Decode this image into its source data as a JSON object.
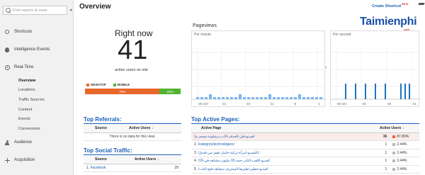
{
  "sidebar": {
    "search_placeholder": "Find reports & more",
    "collapse_glyph": "◂",
    "sections": {
      "shortcuts": "Shortcuts",
      "intelligence": "Intelligence Events",
      "realtime": "Real-Time",
      "audience": "Audience",
      "acquisition": "Acquisition"
    },
    "realtime_items": [
      "Overview",
      "Locations",
      "Traffic Sources",
      "Content",
      "Events",
      "Conversions"
    ]
  },
  "header": {
    "title": "Overview",
    "create_shortcut": "Create Shortcut",
    "beta": "BETA"
  },
  "watermark": {
    "word": "Taimienphi",
    "tld": ".vn"
  },
  "right_now": {
    "title": "Right now",
    "active_users": "41",
    "caption": "active users on site",
    "desktop_label": "DESKTOP",
    "mobile_label": "MOBILE",
    "desktop_pct": "78%",
    "mobile_pct": "22%",
    "desktop_share": 0.78,
    "desktop_color": "#e8672b",
    "mobile_color": "#50b432"
  },
  "pageviews": {
    "title": "Pageviews",
    "per_minute_label": "Per minute",
    "per_second_label": "Per second",
    "minute_ticks": [
      "-26 min",
      "-21",
      "-16",
      "-11",
      "-6",
      "-1"
    ],
    "second_ticks": [
      "-60 sec",
      "-45",
      "-30",
      "-15"
    ],
    "arrow_glyph": "›",
    "bar_color": "#7cb5ec",
    "sec_bar_color": "#1a74c2"
  },
  "referrals": {
    "title": "Top Referrals:",
    "col_source": "Source",
    "col_active": "Active Users",
    "sort_glyph": "↓",
    "empty_text": "There is no data for this view."
  },
  "social": {
    "title": "Top Social Traffic:",
    "col_source": "Source",
    "col_active": "Active Users",
    "sort_glyph": "↓",
    "rows": [
      {
        "idx": "1.",
        "source": "Facebook",
        "users": "29"
      }
    ]
  },
  "pages": {
    "title": "Top Active Pages:",
    "col_page": "Active Page",
    "col_active": "Active Users",
    "sort_glyph": "↓",
    "rows": [
      {
        "idx": "",
        "page": "/فيديو-قبل-الحدف-الاب-برشلونة-يسخر-م/",
        "users": "36",
        "pct": "87.80%"
      },
      {
        "idx": "2.",
        "page": "/category/technologies/",
        "users": "1",
        "pct": "2.44%"
      },
      {
        "idx": "3.",
        "page": "/بالفيديو-امرأة-تركية-حامل-تقفز-من-فندق/",
        "users": "1",
        "pct": "2.44%"
      },
      {
        "idx": "4.",
        "page": "/فيديو-اللعب-البادر-حمد-10-مليون-مشاهد-في-10/",
        "users": "1",
        "pct": "2.44%"
      },
      {
        "idx": "5.",
        "page": "/فيديو-خطير-تطيرها-المحترف-مشاهد-فتح-الباب/",
        "users": "1",
        "pct": "2.44%"
      }
    ]
  }
}
